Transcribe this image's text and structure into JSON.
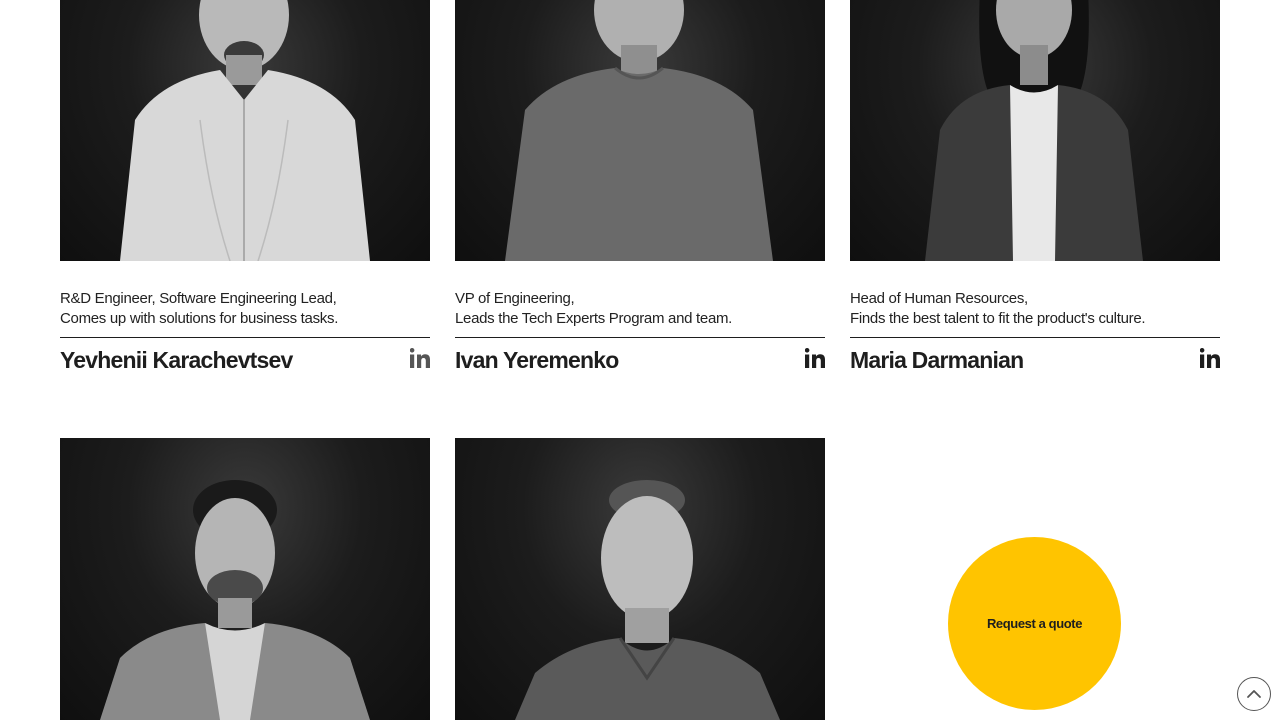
{
  "team": [
    {
      "role_line1": "R&D Engineer, Software Engineering Lead,",
      "role_line2": "Comes up with solutions for business tasks.",
      "name": "Yevhenii Karachevtsev",
      "linkedin_icon": "linkedin-icon"
    },
    {
      "role_line1": "VP of Engineering,",
      "role_line2": "Leads the Tech Experts Program and team.",
      "name": "Ivan Yeremenko",
      "linkedin_icon": "linkedin-icon"
    },
    {
      "role_line1": "Head of Human Resources,",
      "role_line2": "Finds the best talent to fit the product's culture.",
      "name": "Maria Darmanian",
      "linkedin_icon": "linkedin-icon"
    },
    {
      "name": "",
      "photo": "portrait-photo"
    },
    {
      "name": "",
      "photo": "portrait-photo"
    }
  ],
  "cta": {
    "label": "Request a quote",
    "color": "#ffc400"
  },
  "scroll_top": {
    "icon": "chevron-up-icon"
  },
  "colors": {
    "text": "#1e1e1e",
    "background": "#ffffff",
    "accent": "#ffc400"
  }
}
